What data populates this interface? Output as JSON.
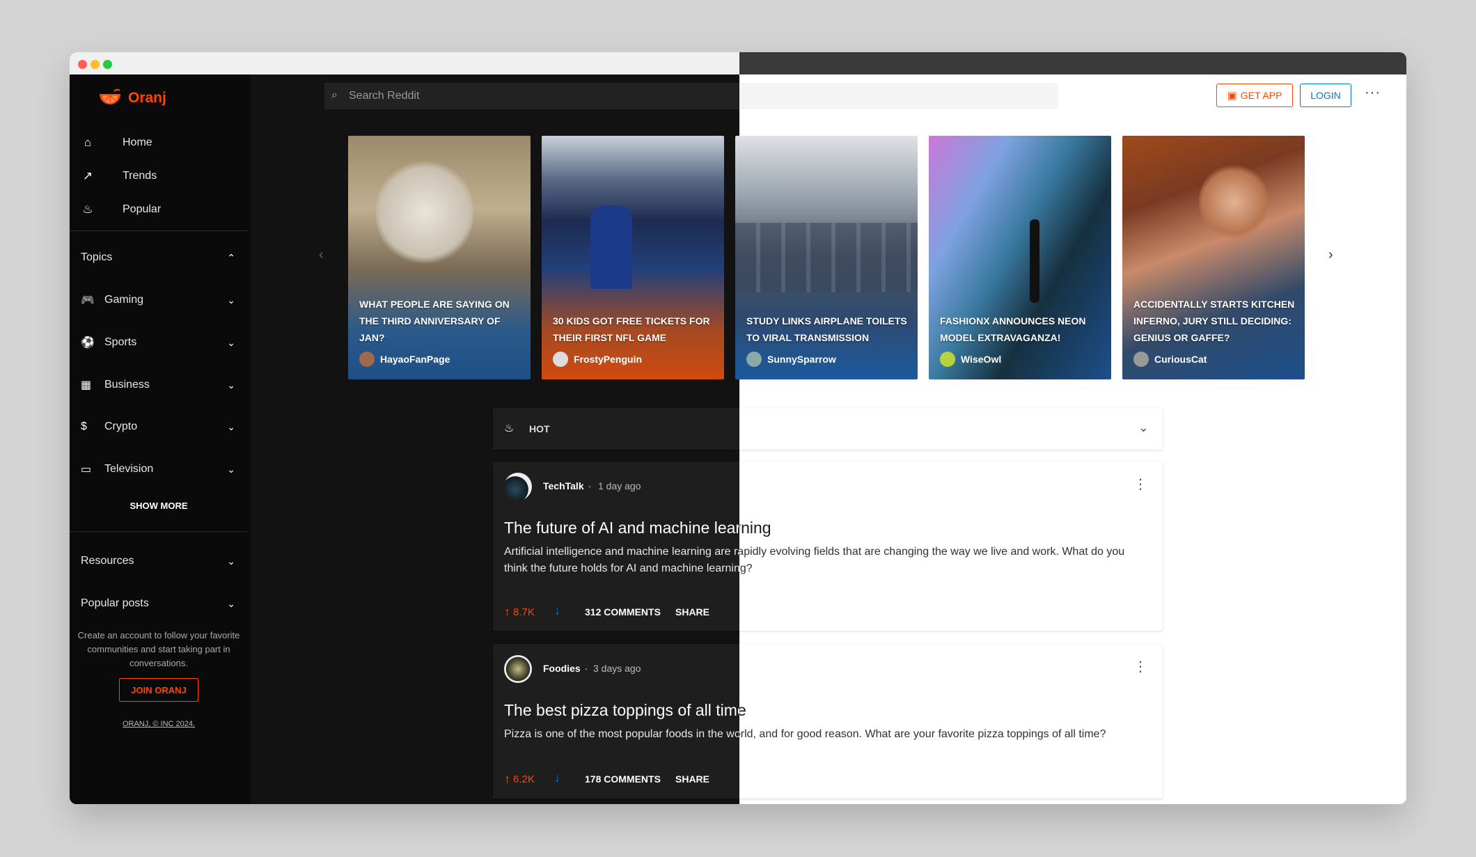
{
  "app": {
    "name": "Oranj"
  },
  "search": {
    "placeholder": "Search Reddit"
  },
  "header": {
    "get_app": "GET APP",
    "login": "LOGIN",
    "more": "···"
  },
  "nav": [
    {
      "label": "Home",
      "icon": "home-icon"
    },
    {
      "label": "Trends",
      "icon": "trend-icon"
    },
    {
      "label": "Popular",
      "icon": "fire-icon"
    }
  ],
  "topics": {
    "header": "Topics",
    "items": [
      {
        "label": "Gaming",
        "icon": "gamepad-icon"
      },
      {
        "label": "Sports",
        "icon": "ball-icon"
      },
      {
        "label": "Business",
        "icon": "building-icon"
      },
      {
        "label": "Crypto",
        "icon": "coin-icon"
      },
      {
        "label": "Television",
        "icon": "tv-icon"
      }
    ],
    "show_more": "SHOW MORE"
  },
  "resources": "Resources",
  "popular_posts": "Popular posts",
  "promo": {
    "text": "Create an account to follow your favorite communities and start taking part in conversations.",
    "join": "JOIN ORANJ",
    "copyright": "ORANJ, © INC 2024."
  },
  "cards": [
    {
      "title": "What people are saying on the third anniversary of Jan?",
      "author": "HayaoFanPage"
    },
    {
      "title": "30 kids got free tickets for their first NFL game",
      "author": "FrostyPenguin"
    },
    {
      "title": "Study links airplane toilets to viral transmission",
      "author": "SunnySparrow"
    },
    {
      "title": "FashionX announces neon model extravaganza!",
      "author": "WiseOwl"
    },
    {
      "title": "Accidentally starts kitchen inferno, jury still deciding: genius or gaffe?",
      "author": "CuriousCat"
    }
  ],
  "sort": {
    "label": "HOT"
  },
  "posts": [
    {
      "author": "TechTalk",
      "separator": ".",
      "time": "1 day ago",
      "title": "The future of AI and machine learning",
      "body": "Artificial intelligence and machine learning are rapidly evolving fields that are changing the way we live and work. What do you think the future holds for AI and machine learning?",
      "upvotes": "8.7K",
      "comments": "312 COMMENTS",
      "share": "SHARE"
    },
    {
      "author": "Foodies",
      "separator": ".",
      "time": "3 days ago",
      "title": "The best pizza toppings of all time",
      "body": "Pizza is one of the most popular foods in the world, and for good reason. What are your favorite pizza toppings of all time?",
      "upvotes": "6.2K",
      "comments": "178 COMMENTS",
      "share": "SHARE"
    }
  ],
  "colors": {
    "accent": "#ff4500",
    "link": "#0079d3",
    "dark_bg": "#121212"
  }
}
